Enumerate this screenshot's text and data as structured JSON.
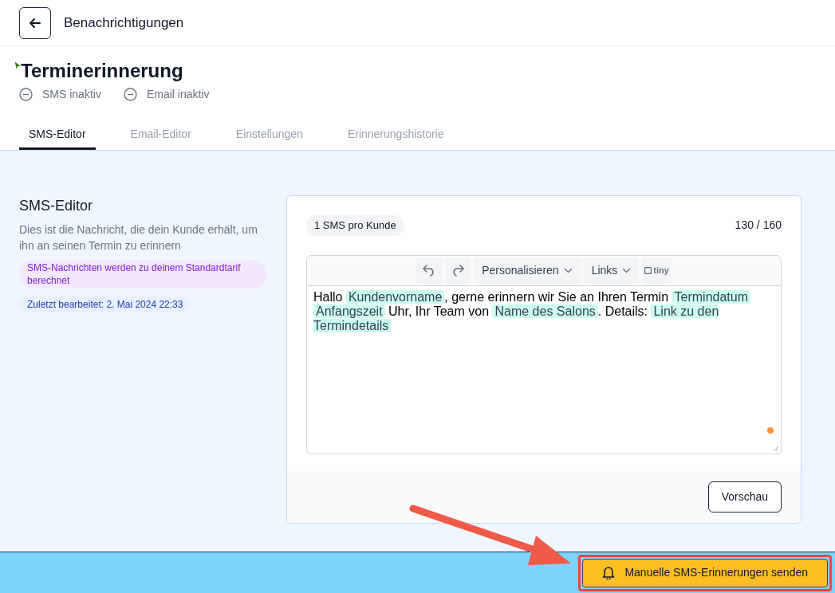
{
  "header": {
    "title": "Benachrichtigungen"
  },
  "heading": "Terminerinnerung",
  "statuses": [
    {
      "label": "SMS inaktiv",
      "active": false
    },
    {
      "label": "Email inaktiv",
      "active": false
    }
  ],
  "tabs": [
    {
      "label": "SMS-Editor",
      "selected": true
    },
    {
      "label": "Email-Editor",
      "selected": false
    },
    {
      "label": "Einstellungen",
      "selected": false
    },
    {
      "label": "Erinnerungshistorie",
      "selected": false
    }
  ],
  "section": {
    "title": "SMS-Editor",
    "description": "Dies ist die Nachricht, die dein Kunde erhält, um ihn an seinen Termin zu erinnern",
    "notes": [
      {
        "kind": "billing",
        "text": "SMS-Nachrichten werden zu deinem Standardtarif berechnet"
      },
      {
        "kind": "edited",
        "text": "Zuletzt bearbeitet: 2. Mai 2024 22:33"
      }
    ]
  },
  "editor": {
    "badge": "1 SMS pro Kunde",
    "counter": "130 / 160",
    "toolbar": {
      "menus": [
        "Personalisieren",
        "Links"
      ],
      "logo": "tiny"
    },
    "message": [
      {
        "kind": "text",
        "text": "Hallo "
      },
      {
        "kind": "tag",
        "text": "Kundenvorname"
      },
      {
        "kind": "text",
        "text": ", gerne erinnern wir Sie an Ihren Termin "
      },
      {
        "kind": "tag",
        "text": "Termindatum"
      },
      {
        "kind": "space"
      },
      {
        "kind": "tag",
        "text": "Anfangszeit"
      },
      {
        "kind": "text",
        "text": " Uhr, Ihr Team von "
      },
      {
        "kind": "tag",
        "text": "Name des Salons"
      },
      {
        "kind": "text",
        "text": ". Details: "
      },
      {
        "kind": "tag",
        "text": "Link zu den Termindetails"
      }
    ],
    "preview_button": "Vorschau"
  },
  "send_button": "Manuelle SMS-Erinnerungen senden"
}
